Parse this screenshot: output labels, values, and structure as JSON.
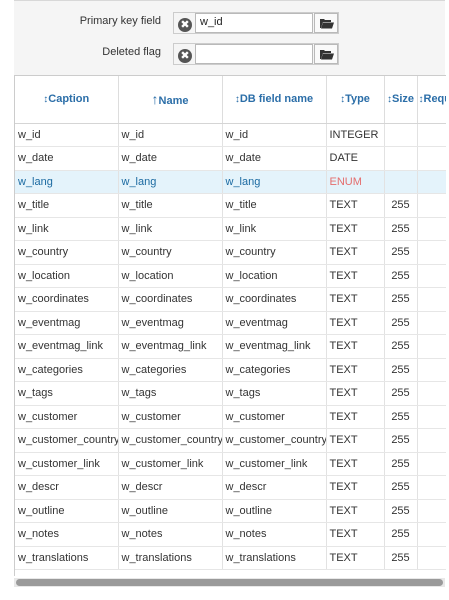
{
  "form": {
    "primary_key_label": "Primary key field",
    "primary_key_value": "w_id",
    "deleted_flag_label": "Deleted flag",
    "deleted_flag_value": "",
    "clear_glyph": "✖",
    "folder_icon": "folder-open-icon"
  },
  "grid": {
    "columns": [
      {
        "label": "Caption",
        "sort": "↕"
      },
      {
        "label": "Name",
        "sort": "↑"
      },
      {
        "label": "DB field name",
        "sort": "↕"
      },
      {
        "label": "Type",
        "sort": "↕"
      },
      {
        "label": "Size",
        "sort": "↕"
      },
      {
        "label": "Requ",
        "sort": "↕"
      }
    ],
    "rows": [
      {
        "caption": "w_id",
        "name": "w_id",
        "db": "w_id",
        "type": "INTEGER",
        "size": ""
      },
      {
        "caption": "w_date",
        "name": "w_date",
        "db": "w_date",
        "type": "DATE",
        "size": ""
      },
      {
        "caption": "w_lang",
        "name": "w_lang",
        "db": "w_lang",
        "type": "ENUM",
        "size": "",
        "selected": true
      },
      {
        "caption": "w_title",
        "name": "w_title",
        "db": "w_title",
        "type": "TEXT",
        "size": "255"
      },
      {
        "caption": "w_link",
        "name": "w_link",
        "db": "w_link",
        "type": "TEXT",
        "size": "255"
      },
      {
        "caption": "w_country",
        "name": "w_country",
        "db": "w_country",
        "type": "TEXT",
        "size": "255"
      },
      {
        "caption": "w_location",
        "name": "w_location",
        "db": "w_location",
        "type": "TEXT",
        "size": "255"
      },
      {
        "caption": "w_coordinates",
        "name": "w_coordinates",
        "db": "w_coordinates",
        "type": "TEXT",
        "size": "255"
      },
      {
        "caption": "w_eventmag",
        "name": "w_eventmag",
        "db": "w_eventmag",
        "type": "TEXT",
        "size": "255"
      },
      {
        "caption": "w_eventmag_link",
        "name": "w_eventmag_link",
        "db": "w_eventmag_link",
        "type": "TEXT",
        "size": "255"
      },
      {
        "caption": "w_categories",
        "name": "w_categories",
        "db": "w_categories",
        "type": "TEXT",
        "size": "255"
      },
      {
        "caption": "w_tags",
        "name": "w_tags",
        "db": "w_tags",
        "type": "TEXT",
        "size": "255"
      },
      {
        "caption": "w_customer",
        "name": "w_customer",
        "db": "w_customer",
        "type": "TEXT",
        "size": "255"
      },
      {
        "caption": "w_customer_country",
        "name": "w_customer_country",
        "db": "w_customer_country",
        "type": "TEXT",
        "size": "255"
      },
      {
        "caption": "w_customer_link",
        "name": "w_customer_link",
        "db": "w_customer_link",
        "type": "TEXT",
        "size": "255"
      },
      {
        "caption": "w_descr",
        "name": "w_descr",
        "db": "w_descr",
        "type": "TEXT",
        "size": "255"
      },
      {
        "caption": "w_outline",
        "name": "w_outline",
        "db": "w_outline",
        "type": "TEXT",
        "size": "255"
      },
      {
        "caption": "w_notes",
        "name": "w_notes",
        "db": "w_notes",
        "type": "TEXT",
        "size": "255"
      },
      {
        "caption": "w_translations",
        "name": "w_translations",
        "db": "w_translations",
        "type": "TEXT",
        "size": "255"
      }
    ]
  }
}
